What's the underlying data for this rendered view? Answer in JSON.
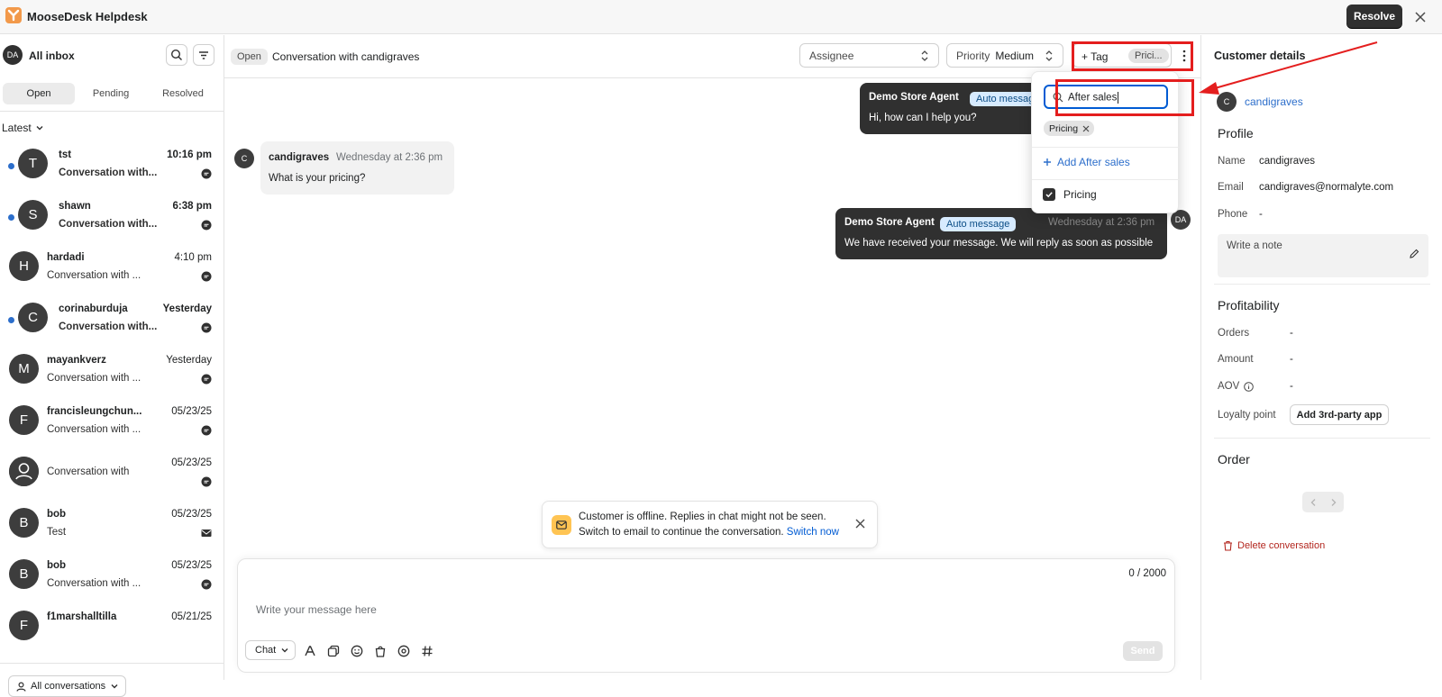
{
  "app": {
    "title": "MooseDesk Helpdesk",
    "resolve_label": "Resolve"
  },
  "sidebar": {
    "avatar": "DA",
    "title": "All inbox",
    "tabs": [
      "Open",
      "Pending",
      "Resolved"
    ],
    "active_tab": "Open",
    "sort_label": "Latest",
    "footer_label": "All conversations",
    "conversations": [
      {
        "initial": "T",
        "name": "tst",
        "time": "10:16 pm",
        "preview": "Conversation with...",
        "unread": true,
        "channel": "chat"
      },
      {
        "initial": "S",
        "name": "shawn",
        "time": "6:38 pm",
        "preview": "Conversation with...",
        "unread": true,
        "channel": "chat"
      },
      {
        "initial": "H",
        "name": "hardadi",
        "time": "4:10 pm",
        "preview": "Conversation with ...",
        "unread": false,
        "channel": "chat"
      },
      {
        "initial": "C",
        "name": "corinaburduja",
        "time": "Yesterday",
        "preview": "Conversation with...",
        "unread": true,
        "channel": "chat"
      },
      {
        "initial": "M",
        "name": "mayankverz",
        "time": "Yesterday",
        "preview": "Conversation with ...",
        "unread": false,
        "channel": "chat"
      },
      {
        "initial": "F",
        "name": "francisleungchun...",
        "time": "05/23/25",
        "preview": "Conversation with ...",
        "unread": false,
        "channel": "chat"
      },
      {
        "initial": "",
        "name": "",
        "time": "05/23/25",
        "preview": "Conversation with",
        "unread": false,
        "channel": "chat",
        "anonymous": true
      },
      {
        "initial": "B",
        "name": "bob",
        "time": "05/23/25",
        "preview": "Test",
        "unread": false,
        "channel": "email"
      },
      {
        "initial": "B",
        "name": "bob",
        "time": "05/23/25",
        "preview": "Conversation with ...",
        "unread": false,
        "channel": "chat"
      },
      {
        "initial": "F",
        "name": "f1marshalltilla",
        "time": "05/21/25",
        "preview": "",
        "unread": false,
        "channel": "chat"
      }
    ]
  },
  "chat": {
    "status": "Open",
    "title": "Conversation with candigraves",
    "assignee_placeholder": "Assignee",
    "priority_label": "Priority",
    "priority_value": "Medium",
    "tag_add_label": "+ Tag",
    "tag_chip": "Prici...",
    "messages": [
      {
        "sender": "Demo Store Agent",
        "badge": "Auto message",
        "text": "Hi, how can I help you?",
        "time": ""
      },
      {
        "sender": "candigraves",
        "avatar": "C",
        "time": "Wednesday at 2:36 pm",
        "text": "What is your pricing?"
      },
      {
        "sender": "Demo Store Agent",
        "badge": "Auto message",
        "time": "Wednesday at 2:36 pm",
        "text": "We have received your message. We will reply as soon as possible",
        "avatar": "DA"
      }
    ],
    "banner": {
      "line1": "Customer is offline. Replies in chat might not be seen.",
      "line2": "Switch to email to continue the conversation.",
      "link": "Switch now"
    },
    "composer": {
      "counter": "0 / 2000",
      "placeholder": "Write your message here",
      "channel": "Chat",
      "send_label": "Send"
    }
  },
  "tag_dropdown": {
    "search_value": "After sales",
    "selected_chip": "Pricing",
    "add_label": "Add After sales",
    "options": [
      {
        "label": "Pricing",
        "checked": true
      }
    ]
  },
  "customer": {
    "panel_title": "Customer details",
    "avatar": "C",
    "username": "candigraves",
    "profile_title": "Profile",
    "fields": [
      {
        "label": "Name",
        "value": "candigraves"
      },
      {
        "label": "Email",
        "value": "candigraves@normalyte.com"
      },
      {
        "label": "Phone",
        "value": "-"
      }
    ],
    "note_placeholder": "Write a note",
    "profitability_title": "Profitability",
    "profitability": [
      {
        "label": "Orders",
        "value": "-"
      },
      {
        "label": "Amount",
        "value": "-"
      },
      {
        "label": "AOV",
        "value": "-"
      }
    ],
    "loyalty_label": "Loyalty point",
    "loyalty_button": "Add 3rd-party app",
    "order_title": "Order",
    "delete_label": "Delete conversation"
  },
  "colors": {
    "accent": "#2c6ecb",
    "highlight": "#e41e1e",
    "dark": "#303030",
    "auto_badge": "#d7ebff"
  }
}
